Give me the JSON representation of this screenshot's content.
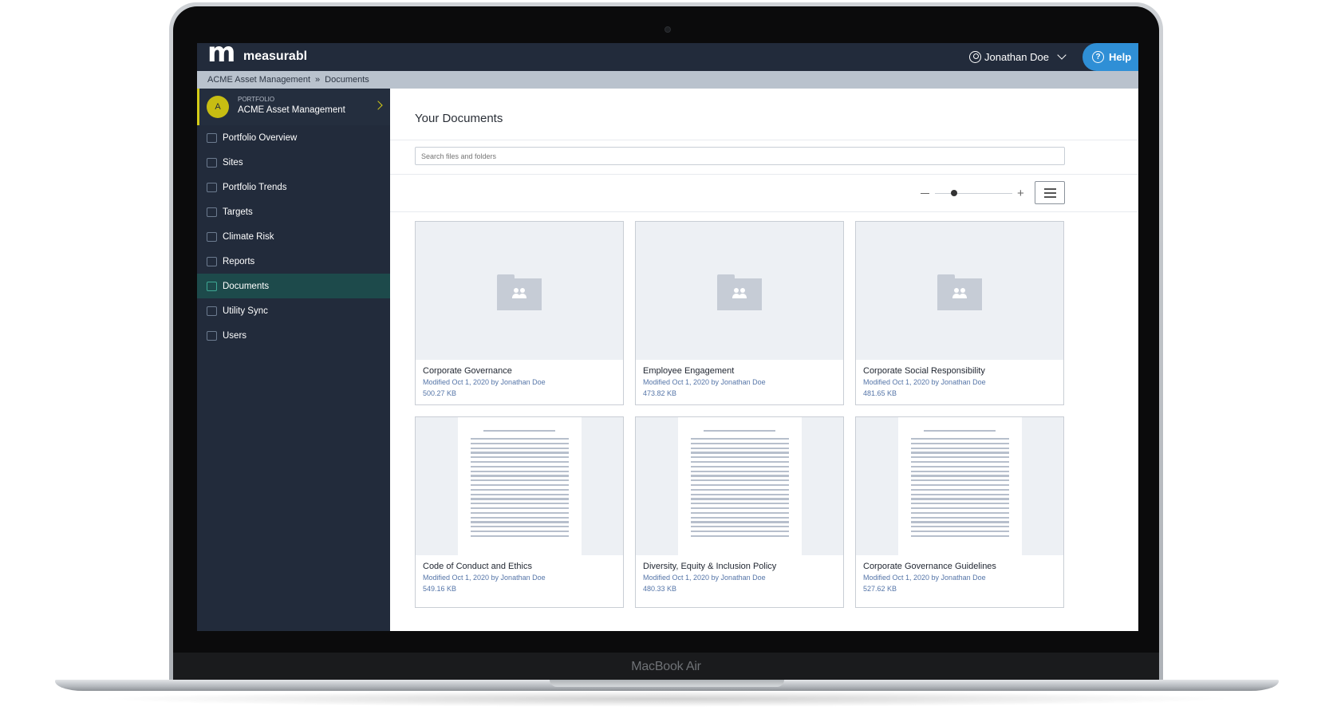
{
  "device": {
    "label": "MacBook Air"
  },
  "app": {
    "brand": "measurabl",
    "logo_letter": "m"
  },
  "header": {
    "user_name": "Jonathan Doe",
    "help_label": "Help",
    "help_glyph": "?"
  },
  "breadcrumb": {
    "items": [
      "ACME Asset Management",
      "Documents"
    ],
    "separator": "»"
  },
  "sidebar": {
    "portfolio": {
      "avatar": "A",
      "label": "PORTFOLIO",
      "name": "ACME Asset Management"
    },
    "items": [
      {
        "label": "Portfolio Overview",
        "icon": "chart-icon"
      },
      {
        "label": "Sites",
        "icon": "building-icon"
      },
      {
        "label": "Portfolio Trends",
        "icon": "trend-icon"
      },
      {
        "label": "Targets",
        "icon": "target-icon"
      },
      {
        "label": "Climate Risk",
        "icon": "climate-icon"
      },
      {
        "label": "Reports",
        "icon": "report-icon"
      },
      {
        "label": "Documents",
        "icon": "documents-icon",
        "active": true
      },
      {
        "label": "Utility Sync",
        "icon": "sync-icon"
      },
      {
        "label": "Users",
        "icon": "users-icon"
      }
    ]
  },
  "main": {
    "title": "Your Documents",
    "search_placeholder": "Search files and folders",
    "zoom": {
      "minus": "−",
      "plus": "+",
      "level": 0.25
    },
    "cards": [
      {
        "type": "folder",
        "title": "Corporate Governance",
        "meta": "Modified Oct 1, 2020 by Jonathan Doe",
        "size": "500.27 KB"
      },
      {
        "type": "folder",
        "title": "Employee Engagement",
        "meta": "Modified Oct 1, 2020 by Jonathan Doe",
        "size": "473.82 KB"
      },
      {
        "type": "folder",
        "title": "Corporate Social Responsibility",
        "meta": "Modified Oct 1, 2020 by Jonathan Doe",
        "size": "481.65 KB"
      },
      {
        "type": "document",
        "title": "Code of Conduct and Ethics",
        "meta": "Modified Oct 1, 2020 by Jonathan Doe",
        "size": "549.16 KB"
      },
      {
        "type": "document",
        "title": "Diversity, Equity & Inclusion Policy",
        "meta": "Modified Oct 1, 2020 by Jonathan Doe",
        "size": "480.33 KB"
      },
      {
        "type": "document",
        "title": "Corporate Governance Guidelines",
        "meta": "Modified Oct 1, 2020 by Jonathan Doe",
        "size": "527.62 KB"
      }
    ]
  },
  "colors": {
    "topbar": "#222b3b",
    "help": "#2f8fd6",
    "accent": "#d4cc18",
    "active_nav": "#1d4a4b",
    "meta_text": "#5575a8"
  }
}
